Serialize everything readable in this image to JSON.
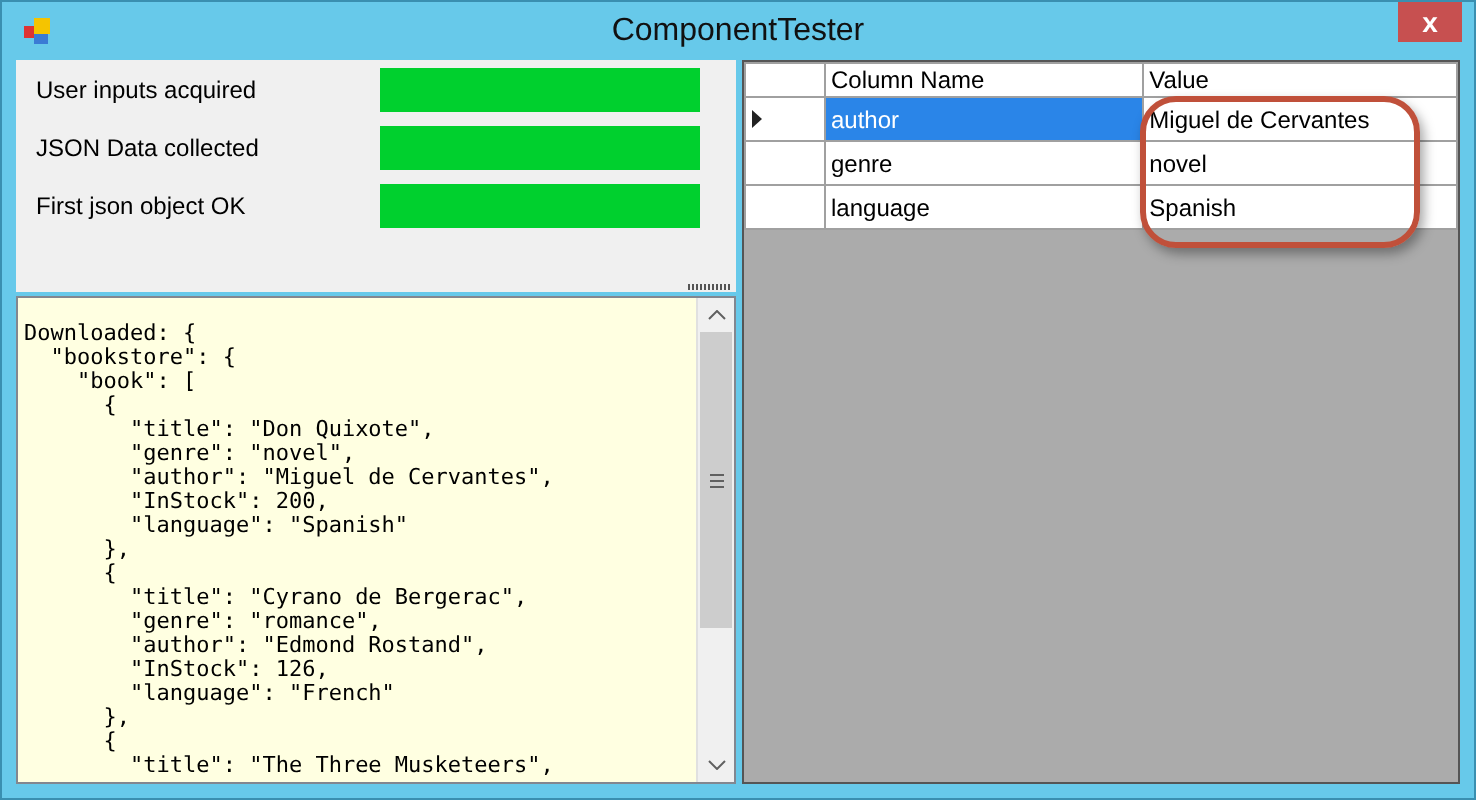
{
  "window": {
    "title": "ComponentTester",
    "close": "x"
  },
  "statuses": [
    {
      "label": "User inputs acquired",
      "level": 1
    },
    {
      "label": "JSON Data collected",
      "level": 1
    },
    {
      "label": "First json object OK",
      "level": 1
    }
  ],
  "output": {
    "lines": [
      "Downloaded: {",
      "  \"bookstore\": {",
      "    \"book\": [",
      "      {",
      "        \"title\": \"Don Quixote\",",
      "        \"genre\": \"novel\",",
      "        \"author\": \"Miguel de Cervantes\",",
      "        \"InStock\": 200,",
      "        \"language\": \"Spanish\"",
      "      },",
      "      {",
      "        \"title\": \"Cyrano de Bergerac\",",
      "        \"genre\": \"romance\",",
      "        \"author\": \"Edmond Rostand\",",
      "        \"InStock\": 126,",
      "        \"language\": \"French\"",
      "      },",
      "      {",
      "        \"title\": \"The Three Musketeers\","
    ]
  },
  "table": {
    "columns": [
      "Column Name",
      "Value"
    ],
    "rows": [
      {
        "name": "author",
        "value": "Miguel de Cervantes",
        "selected": true
      },
      {
        "name": "genre",
        "value": "novel",
        "selected": false
      },
      {
        "name": "language",
        "value": "Spanish",
        "selected": false
      }
    ]
  }
}
